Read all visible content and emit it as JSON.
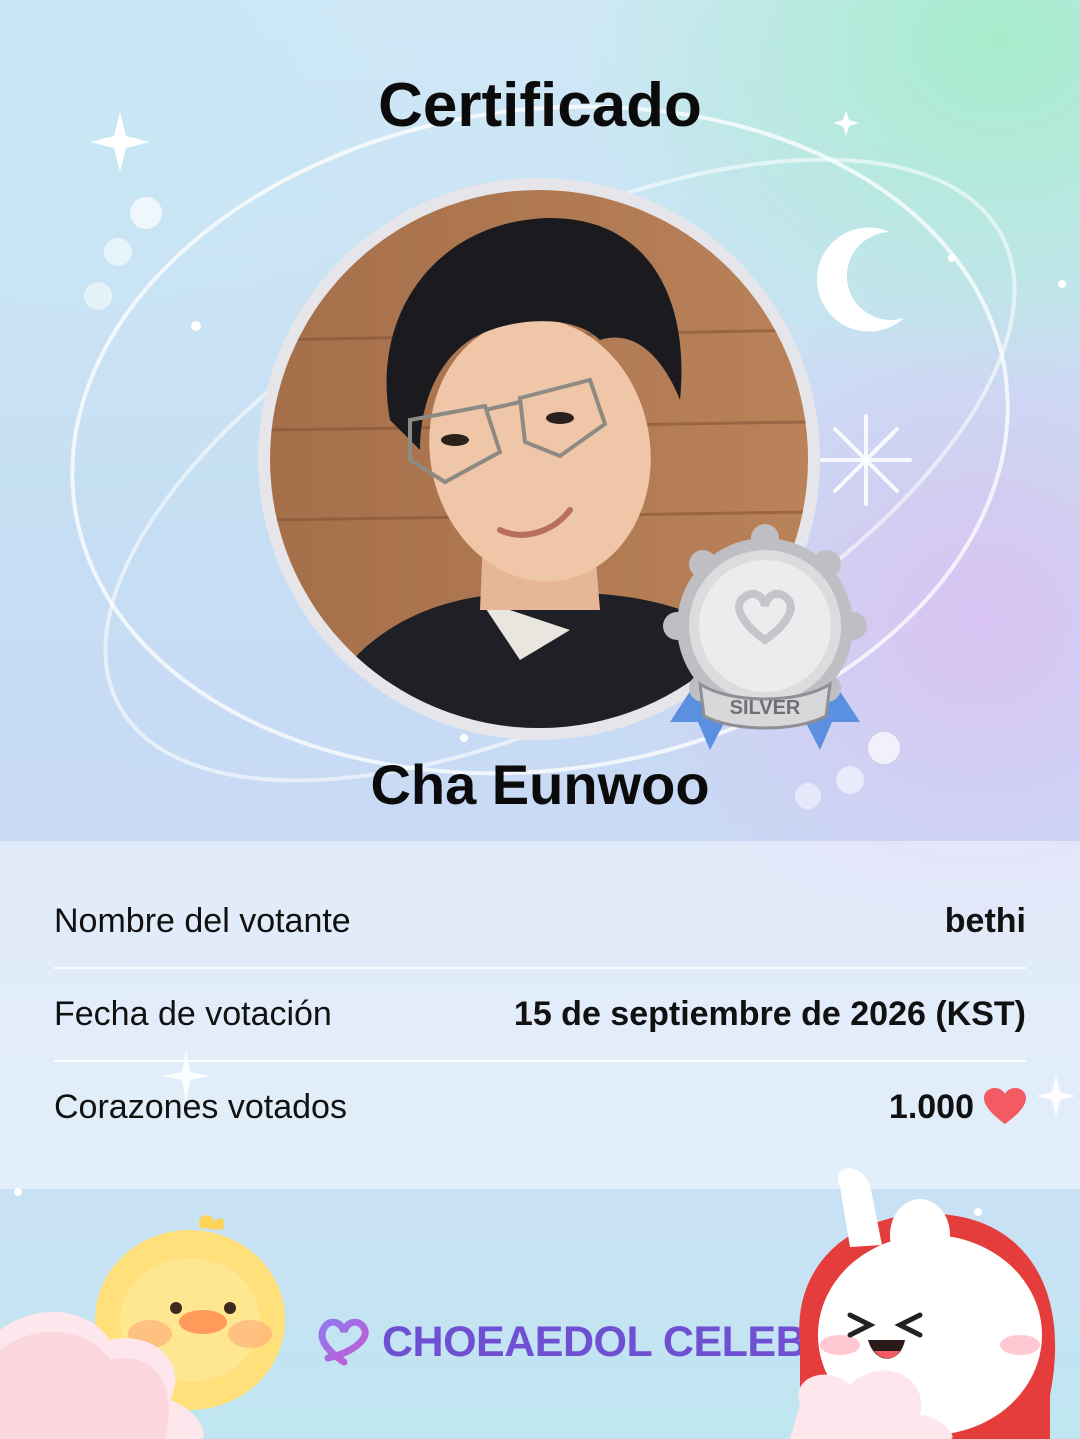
{
  "certificate": {
    "title": "Certificado",
    "celeb_name": "Cha Eunwoo",
    "badge_label": "SILVER"
  },
  "details": [
    {
      "label": "Nombre del votante",
      "value": "bethi"
    },
    {
      "label": "Fecha de votación",
      "value": "15 de septiembre de 2026 (KST)"
    },
    {
      "label": "Corazones votados",
      "value": "1.000"
    }
  ],
  "brand": {
    "name": "CHOEAEDOL CELEB"
  },
  "colors": {
    "heart": "#f25b63",
    "brand": "#6f4fd2",
    "ribbon": "#5b8fe0",
    "medal": "#c9c9cc"
  }
}
